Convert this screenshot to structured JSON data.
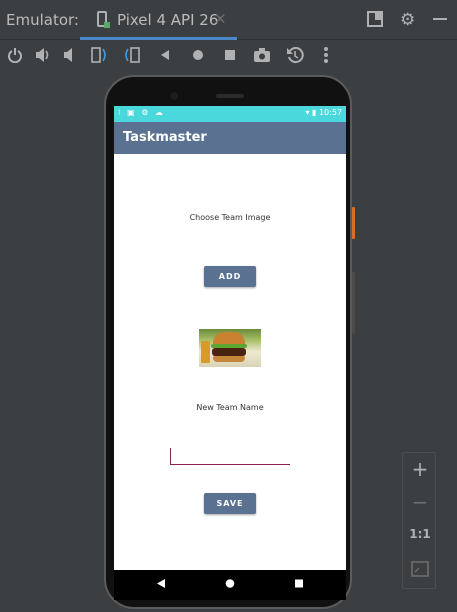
{
  "window": {
    "title": "Emulator:",
    "tab_label": "Pixel 4 API 26",
    "tab_close": "✕"
  },
  "app": {
    "title": "Taskmaster",
    "choose_label": "Choose Team Image",
    "add_label": "ADD",
    "new_team_label": "New Team Name",
    "team_name_value": "",
    "save_label": "SAVE"
  },
  "status_bar": {
    "left_icons": "⁝ ▣ ⚙ ☁",
    "right_icons": "▾ ▮ 10:57"
  },
  "zoom_panel": {
    "plus": "+",
    "minus": "−",
    "one_to_one": "1:1"
  },
  "colors": {
    "accent": "#4a88c7",
    "app_bar": "#5a7192",
    "status_bar": "#4ad8dd",
    "input_line": "#8e2151"
  }
}
